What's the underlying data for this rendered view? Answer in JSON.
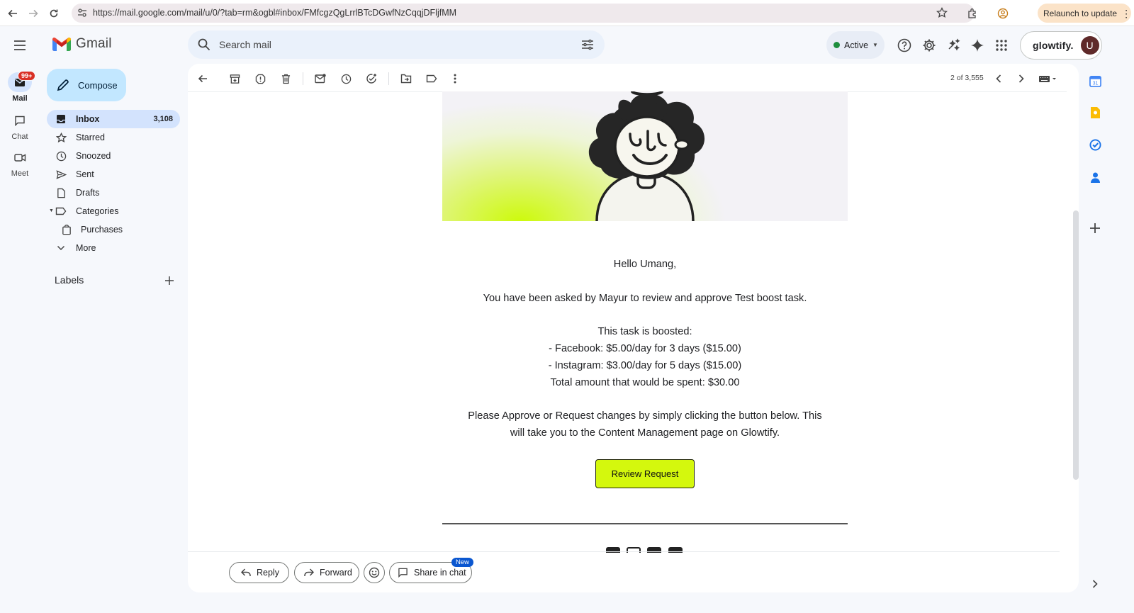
{
  "browser": {
    "url": "https://mail.google.com/mail/u/0/?tab=rm&ogbl#inbox/FMfcgzQgLrrlBTcDGwfNzCqqjDFljfMM",
    "relaunch_label": "Relaunch to update"
  },
  "rail": {
    "badge": "99+",
    "items": [
      {
        "label": "Mail"
      },
      {
        "label": "Chat"
      },
      {
        "label": "Meet"
      }
    ]
  },
  "header": {
    "app_name": "Gmail",
    "search_placeholder": "Search mail",
    "status": "Active",
    "account_name": "glowtify.",
    "avatar_letter": "U"
  },
  "sidebar": {
    "compose_label": "Compose",
    "items": [
      {
        "label": "Inbox",
        "count": "3,108",
        "icon": "inbox-icon"
      },
      {
        "label": "Starred",
        "icon": "star-icon"
      },
      {
        "label": "Snoozed",
        "icon": "clock-icon"
      },
      {
        "label": "Sent",
        "icon": "send-icon"
      },
      {
        "label": "Drafts",
        "icon": "draft-icon"
      },
      {
        "label": "Categories",
        "icon": "label-icon"
      },
      {
        "label": "Purchases",
        "icon": "shopping-bag-icon"
      },
      {
        "label": "More",
        "icon": "chevron-down-icon"
      }
    ],
    "labels_title": "Labels"
  },
  "toolbar": {
    "counter": "2 of 3,555"
  },
  "email": {
    "greeting": "Hello Umang,",
    "intro": "You have been asked by Mayur to review and approve Test boost task.",
    "boost_heading": "This task is boosted:",
    "boost_lines": [
      "- Facebook: $5.00/day for 3 days ($15.00)",
      "- Instagram: $3.00/day for 5 days ($15.00)",
      "Total amount that would be spent: $30.00"
    ],
    "cta_text_line1": "Please Approve or Request changes by simply clicking the button below. This",
    "cta_text_line2": "will take you to the Content Management page on Glowtify.",
    "button_label": "Review Request"
  },
  "actions": {
    "reply": "Reply",
    "forward": "Forward",
    "share": "Share in chat",
    "new_badge": "New"
  },
  "colors": {
    "accent_lime": "#d4f80d",
    "gmail_selected": "#d3e3fd",
    "compose_bg": "#c2e7ff",
    "badge_red": "#d93025",
    "active_green": "#1e8e3e"
  }
}
